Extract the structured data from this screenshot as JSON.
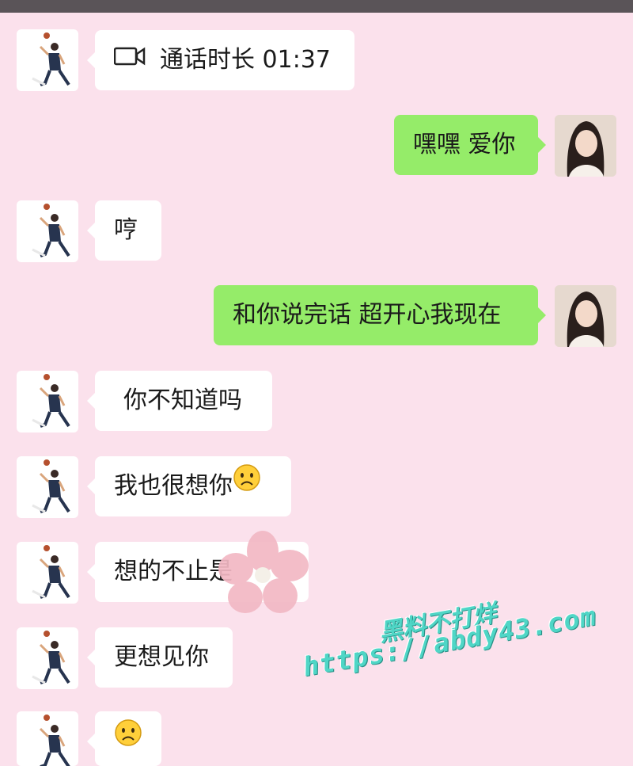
{
  "chat": {
    "messages": [
      {
        "side": "in",
        "text": "通话时长 01:37",
        "icon": "video-call-icon"
      },
      {
        "side": "out",
        "text": "嘿嘿 爱你"
      },
      {
        "side": "in",
        "text": "哼"
      },
      {
        "side": "out",
        "text": "和你说完话 超开心我现在"
      },
      {
        "side": "in",
        "text": "你不知道吗"
      },
      {
        "side": "in",
        "text": "我也很想你",
        "emoji": "sad-face-emoji"
      },
      {
        "side": "in",
        "text": "想的不止是"
      },
      {
        "side": "in",
        "text": "更想见你"
      },
      {
        "side": "in",
        "text": "",
        "emoji": "sad-face-emoji"
      }
    ]
  },
  "watermark": {
    "line1": "黑料不打烊",
    "line2": "https://abdy43.com"
  },
  "colors": {
    "background": "#fbe1ec",
    "incoming_bubble": "#ffffff",
    "outgoing_bubble": "#95ec69",
    "watermark": "#4fd6c6"
  }
}
